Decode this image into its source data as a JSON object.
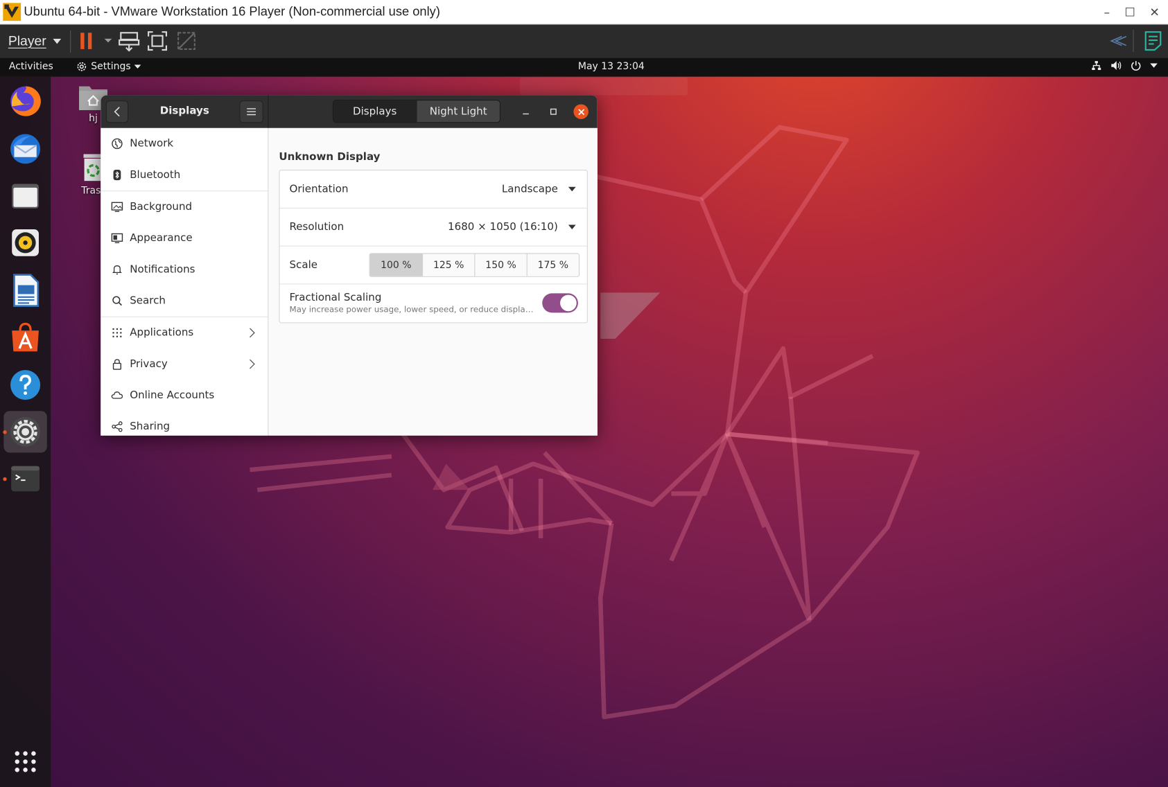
{
  "vmware": {
    "window_title": "Ubuntu 64-bit - VMware Workstation 16 Player (Non-commercial use only)",
    "menu_label": "Player",
    "accent": "#e95420"
  },
  "top_panel": {
    "activities": "Activities",
    "app_menu": "Settings",
    "clock": "May 13  23:04"
  },
  "desktop": {
    "icons": [
      {
        "label": "hj",
        "icon": "home-folder-icon"
      },
      {
        "label": "Tras",
        "icon": "trash-icon"
      }
    ]
  },
  "dock": {
    "apps": [
      "firefox-icon",
      "thunderbird-icon",
      "files-icon",
      "rhythmbox-icon",
      "libreoffice-writer-icon",
      "software-icon",
      "help-icon",
      "settings-icon",
      "terminal-icon",
      "show-apps-icon"
    ],
    "active": "settings-icon"
  },
  "settings_window": {
    "sidebar_title": "Displays",
    "tabs": [
      {
        "label": "Displays",
        "selected": true
      },
      {
        "label": "Night Light",
        "selected": false
      }
    ],
    "sidebar_items": [
      {
        "label": "Network",
        "icon": "network-icon"
      },
      {
        "label": "Bluetooth",
        "icon": "bluetooth-icon"
      },
      {
        "label": "Background",
        "icon": "background-icon"
      },
      {
        "label": "Appearance",
        "icon": "appearance-icon"
      },
      {
        "label": "Notifications",
        "icon": "bell-icon"
      },
      {
        "label": "Search",
        "icon": "search-icon"
      },
      {
        "label": "Applications",
        "icon": "apps-grid-icon",
        "has_submenu": true
      },
      {
        "label": "Privacy",
        "icon": "lock-icon",
        "has_submenu": true
      },
      {
        "label": "Online Accounts",
        "icon": "cloud-icon"
      },
      {
        "label": "Sharing",
        "icon": "share-icon"
      }
    ],
    "display_heading": "Unknown Display",
    "orientation": {
      "label": "Orientation",
      "value": "Landscape"
    },
    "resolution": {
      "label": "Resolution",
      "value": "1680 × 1050 (16:10)"
    },
    "scale": {
      "label": "Scale",
      "options": [
        "100 %",
        "125 %",
        "150 %",
        "175 %"
      ],
      "selected": "100 %"
    },
    "fractional_scaling": {
      "label": "Fractional Scaling",
      "description": "May increase power usage, lower speed, or reduce display sharpness.",
      "enabled": true,
      "toggle_color": "#924d8b"
    }
  }
}
